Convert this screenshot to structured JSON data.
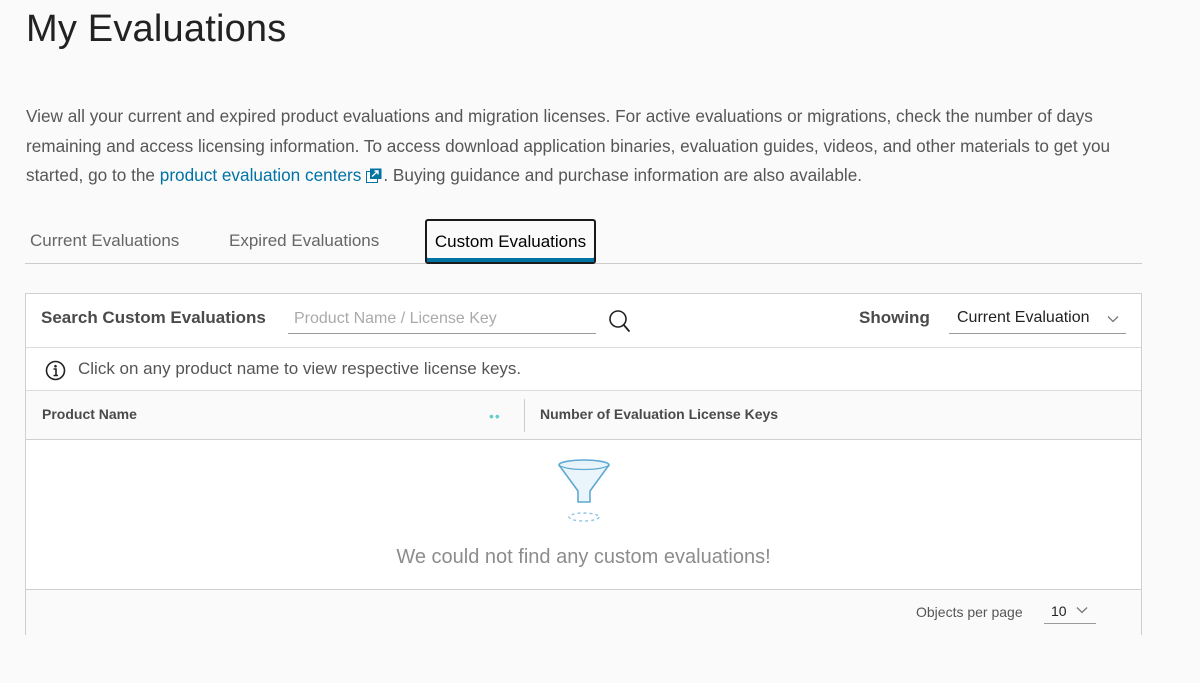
{
  "page": {
    "title": "My Evaluations"
  },
  "intro": {
    "text_before_link": "View all your current and expired product evaluations and migration licenses. For active evaluations or migrations, check the number of days remaining and access licensing information. To access download application binaries, evaluation guides, videos, and other materials to get you started, go to the ",
    "link_text": "product evaluation centers",
    "text_after_link": ". Buying guidance and purchase information are also available."
  },
  "tabs": [
    {
      "label": "Current Evaluations",
      "active": false
    },
    {
      "label": "Expired Evaluations",
      "active": false
    },
    {
      "label": "Custom Evaluations",
      "active": true
    }
  ],
  "search": {
    "label": "Search Custom Evaluations",
    "placeholder": "Product Name / License Key",
    "value": ""
  },
  "showing": {
    "label": "Showing",
    "selected": "Current Evaluation"
  },
  "info": {
    "text": "Click on any product name to view respective license keys."
  },
  "grid": {
    "columns": [
      "Product Name",
      "Number of Evaluation License Keys"
    ],
    "rows": [],
    "empty_message": "We could not find any custom evaluations!"
  },
  "pagination": {
    "objects_per_page_label": "Objects per page",
    "objects_per_page_value": "10"
  },
  "colors": {
    "link": "#0072a3",
    "active_tab_underline": "#0072a3",
    "funnel_icon": "#5fa8d3"
  }
}
